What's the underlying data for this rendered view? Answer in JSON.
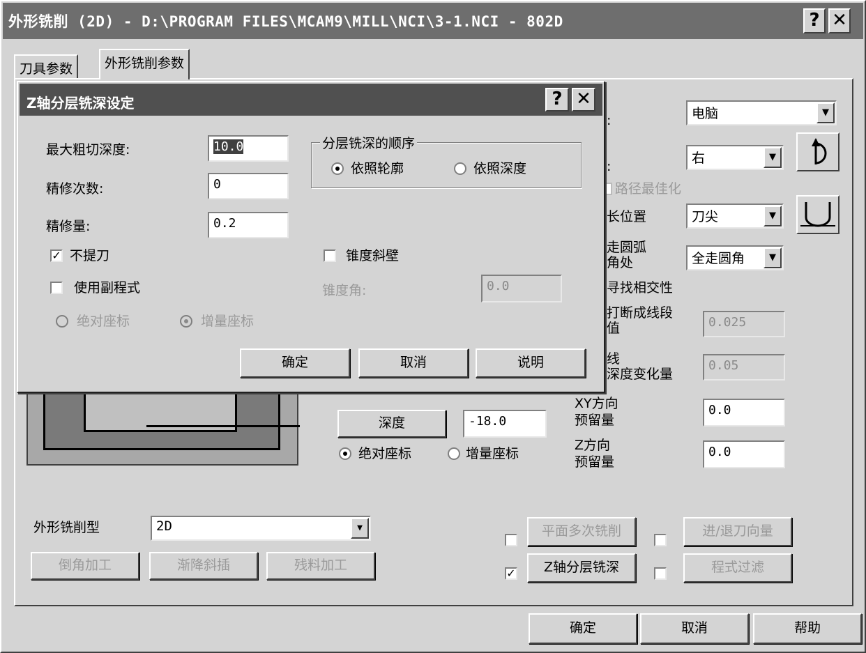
{
  "window": {
    "title": "外形铣削 (2D) - D:\\PROGRAM FILES\\MCAM9\\MILL\\NCI\\3-1.NCI - 802D",
    "help_glyph": "?",
    "close_glyph": "✕"
  },
  "tabs": [
    {
      "label": "刀具参数"
    },
    {
      "label": "外形铣削参数"
    }
  ],
  "right_panel": {
    "colon1": ":",
    "colon2": ":",
    "compensation_type": "电脑",
    "compensation_dir": "右",
    "optimize_label": "路径最佳化",
    "tip_comp_label": "长位置",
    "tip_comp_value": "刀尖",
    "corner_label_line1": "走圆弧",
    "corner_label_line2": "角处",
    "corner_value": "全走圆角",
    "intersect_label": "寻找相交性",
    "break_label_line1": "打断成线段",
    "break_label_line2": "值",
    "break_value": "0.025",
    "depth_change_line1": "线",
    "depth_change_line2": "深度变化量",
    "depth_change_value": "0.05",
    "xy_stock_line1": "XY方向",
    "xy_stock_line2": "预留量",
    "xy_stock_value": "0.0",
    "z_stock_line1": "Z方向",
    "z_stock_line2": "预留量",
    "z_stock_value": "0.0"
  },
  "depth": {
    "button": "深度",
    "value": "-18.0",
    "abs_label": "绝对座标",
    "inc_label": "增量座标"
  },
  "contour_type": {
    "label": "外形铣削型",
    "value": "2D"
  },
  "bottom_buttons": {
    "chamfer": "倒角加工",
    "ramp": "渐降斜插",
    "remachining": "残料加工",
    "multipass": "平面多次铣削",
    "leadin": "进/退刀向量",
    "depthcuts": "Z轴分层铣深",
    "filter": "程式过滤",
    "depthcuts_checked": true
  },
  "footer": {
    "ok": "确定",
    "cancel": "取消",
    "help": "帮助"
  },
  "dialog": {
    "title": "Z轴分层铣深设定",
    "max_rough_label": "最大粗切深度:",
    "max_rough_value": "10.0",
    "finish_passes_label": "精修次数:",
    "finish_passes_value": "0",
    "finish_step_label": "精修量:",
    "finish_step_value": "0.2",
    "no_retract_label": "不提刀",
    "no_retract_checked": true,
    "subprogram_label": "使用副程式",
    "abs_label": "绝对座标",
    "inc_label": "增量座标",
    "order_group_label": "分层铣深的顺序",
    "by_contour_label": "依照轮廓",
    "by_depth_label": "依照深度",
    "taper_label": "锥度斜壁",
    "taper_angle_label": "锥度角:",
    "taper_angle_value": "0.0",
    "ok": "确定",
    "cancel": "取消",
    "help": "说明"
  }
}
